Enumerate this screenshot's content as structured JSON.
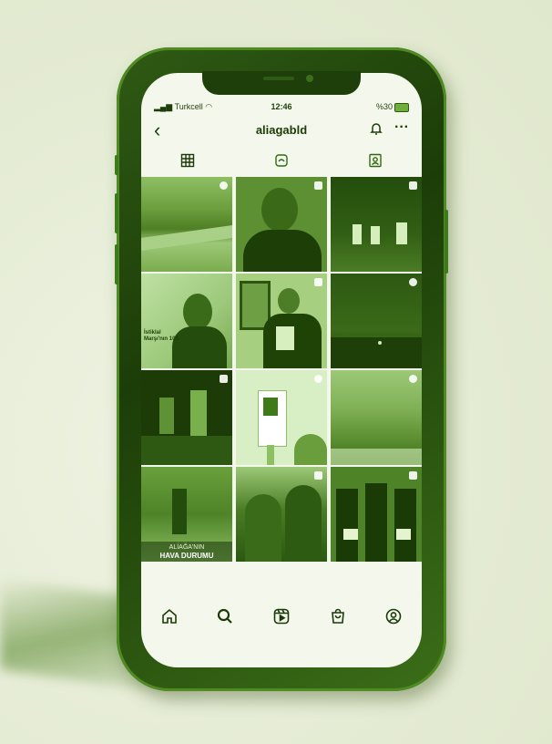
{
  "status_bar": {
    "carrier": "Turkcell",
    "time": "12:46",
    "battery": "%30"
  },
  "profile": {
    "username": "aliagabld"
  },
  "icons": {
    "back": "chevron-left-icon",
    "notifications": "bell-icon",
    "more": "more-icon",
    "tab_grid": "grid-icon",
    "tab_reels": "reels-icon",
    "tab_tagged": "tagged-icon",
    "nav_home": "home-icon",
    "nav_search": "search-icon",
    "nav_reels": "reels-icon",
    "nav_shop": "shop-bag-icon",
    "nav_profile": "profile-icon"
  },
  "grid_posts": [
    {
      "scene": "road landscape"
    },
    {
      "scene": "man portrait"
    },
    {
      "scene": "stage performance"
    },
    {
      "scene": "poet portrait poster",
      "caption_line": "İstiklal Marşı'nın 100."
    },
    {
      "scene": "man holding book"
    },
    {
      "scene": "night street"
    },
    {
      "scene": "night workers"
    },
    {
      "scene": "building sign"
    },
    {
      "scene": "hills view"
    },
    {
      "scene": "woman in field",
      "caption_small": "ALİAĞA'NIN",
      "caption_bold": "HAVA DURUMU"
    },
    {
      "scene": "trees and plants"
    },
    {
      "scene": "award ceremony"
    }
  ],
  "colors": {
    "accent": "#2f5a14",
    "screen_bg": "#f4f8ec",
    "page_bg": "#e6ecd6"
  }
}
